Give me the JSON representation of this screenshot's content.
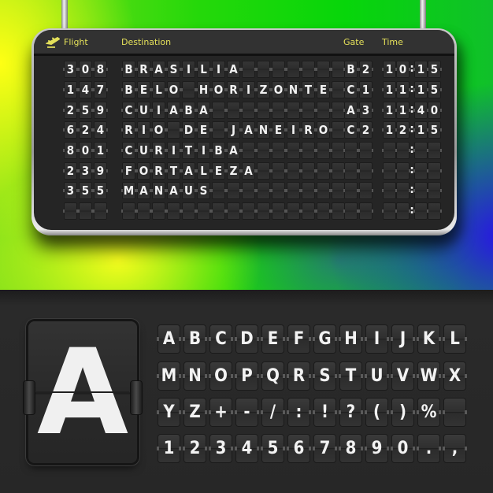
{
  "board": {
    "headers": {
      "icon": "plane-departure-icon",
      "flight": "Flight",
      "destination": "Destination",
      "gate": "Gate",
      "time": "Time"
    },
    "accent_color": "#e4e05a",
    "destination_tile_count": 15,
    "rows": [
      {
        "flight": "308",
        "destination": "BRASILIA",
        "gate": "B2",
        "time": "10:15"
      },
      {
        "flight": "147",
        "destination": "BELO HORIZONTE",
        "gate": "C1",
        "time": "11:15"
      },
      {
        "flight": "259",
        "destination": "CUIABA",
        "gate": "A3",
        "time": "11:40"
      },
      {
        "flight": "624",
        "destination": "RIO DE JANEIRO",
        "gate": "C2",
        "time": "12:15"
      },
      {
        "flight": "801",
        "destination": "CURITIBA",
        "gate": "",
        "time": ":"
      },
      {
        "flight": "239",
        "destination": "FORTALEZA",
        "gate": "",
        "time": ":"
      },
      {
        "flight": "355",
        "destination": "MANAUS",
        "gate": "",
        "time": ":"
      },
      {
        "flight": "",
        "destination": "",
        "gate": "",
        "time": ":"
      }
    ]
  },
  "featured_tile": {
    "char": "A"
  },
  "character_sheet": {
    "rows": [
      [
        "A",
        "B",
        "C",
        "D",
        "E",
        "F",
        "G",
        "H",
        "I",
        "J",
        "K",
        "L"
      ],
      [
        "M",
        "N",
        "O",
        "P",
        "Q",
        "R",
        "S",
        "T",
        "U",
        "V",
        "W",
        "X"
      ],
      [
        "Y",
        "Z",
        "+",
        "-",
        "/",
        ":",
        "!",
        "?",
        "(",
        ")",
        "%",
        ""
      ],
      [
        "1",
        "2",
        "3",
        "4",
        "5",
        "6",
        "7",
        "8",
        "9",
        "0",
        ".",
        ","
      ]
    ]
  }
}
